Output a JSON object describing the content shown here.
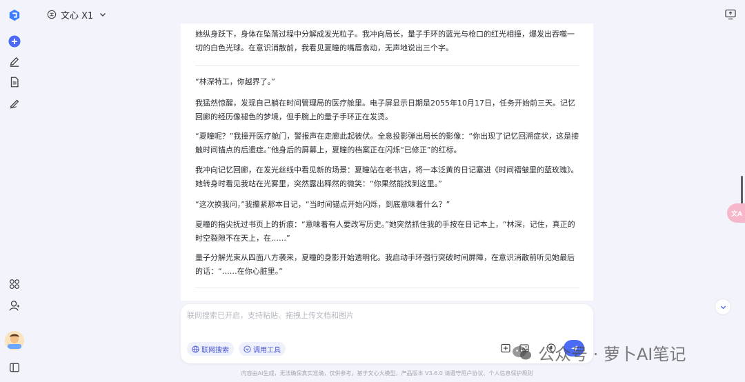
{
  "header": {
    "model_name": "文心 X1"
  },
  "sidebar": {
    "items": [
      {
        "name": "app-logo-icon"
      },
      {
        "name": "new-chat-icon"
      },
      {
        "name": "edit-icon"
      },
      {
        "name": "document-icon"
      },
      {
        "name": "writing-icon"
      },
      {
        "name": "apps-grid-icon"
      },
      {
        "name": "user-icon"
      },
      {
        "name": "avatar"
      },
      {
        "name": "sidebar-toggle-icon"
      }
    ]
  },
  "chat": {
    "paragraphs": [
      "她纵身跃下，身体在坠落过程中分解成发光粒子。我冲向局长，量子手环的蓝光与枪口的红光相撞，爆发出吞噬一切的白色光球。在意识消散前，我看见夏瞳的嘴唇翕动，无声地说出三个字。",
      "“林深特工，你越界了。”",
      "我猛然惊醒，发现自己躺在时间管理局的医疗舱里。电子屏显示日期是2055年10月17日，任务开始前三天。记忆回廊的经历像褪色的梦境，但手腕上的量子手环正在发烫。",
      "“夏瞳呢？”我撞开医疗舱门，警报声在走廊此起彼伏。全息投影弹出局长的影像：“你出现了记忆回溯症状，这是接触时间锚点的后遗症。”他身后的屏幕上，夏瞳的档案正在闪烁“已修正”的红标。",
      "我冲向记忆回廊，在发光丝线中看见新的场景：夏瞳站在老书店，将一本泛黄的日记塞进《时间褶皱里的蓝玫瑰》。她转身时看见我站在光雾里，突然露出释然的微笑：“你果然能找到这里。”",
      "“这次换我问，”我攥紧那本日记，“当时间锚点开始闪烁，到底意味着什么？”",
      "夏瞳的指尖抚过书页上的折痕：“意味着有人要改写历史。”她突然抓住我的手按在日记本上，“林深，记住，真正的时空裂隙不在天上，在……”",
      "量子分解光束从四面八方袭来，夏瞳的身影开始透明化。我启动手环强行突破时间屏障，在意识消散前听见她最后的话：“……在你心脏里。”"
    ]
  },
  "input": {
    "placeholder": "联网搜索已开启，支持粘贴、拖拽上传文档和图片",
    "chip_search": "联网搜索",
    "chip_tools": "调用工具"
  },
  "floating": {
    "translate_label": "文A"
  },
  "watermark": {
    "text": "公众号 · 萝卜AI笔记"
  },
  "footer": {
    "text": "内容由AI生成，无法确保真实准确，仅供参考。基于文心大模型，产品版本 V3.6.0 请遵守用户协议、个人信息保护规则"
  },
  "colors": {
    "accent": "#4b6bf5",
    "background": "#f3f4fb"
  }
}
